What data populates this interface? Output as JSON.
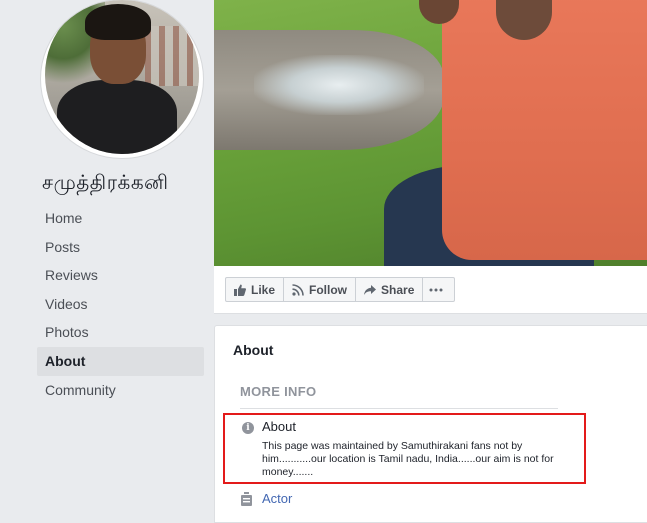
{
  "page": {
    "name": "சமுத்திரக்கனி"
  },
  "nav": {
    "items": [
      {
        "label": "Home"
      },
      {
        "label": "Posts"
      },
      {
        "label": "Reviews"
      },
      {
        "label": "Videos"
      },
      {
        "label": "Photos"
      },
      {
        "label": "About"
      },
      {
        "label": "Community"
      }
    ],
    "active": "About"
  },
  "actions": {
    "like_label": "Like",
    "follow_label": "Follow",
    "share_label": "Share",
    "more_icon": "ellipsis-icon"
  },
  "about": {
    "title": "About",
    "section_header": "MORE INFO",
    "info_label": "About",
    "info_text": "This page was maintained by Samuthirakani fans not by him...........our location is Tamil nadu, India......our aim is not for money.......",
    "category": "Actor"
  },
  "colors": {
    "highlight_border": "#e31a1a",
    "link": "#4267b2",
    "background": "#e9ebee"
  }
}
